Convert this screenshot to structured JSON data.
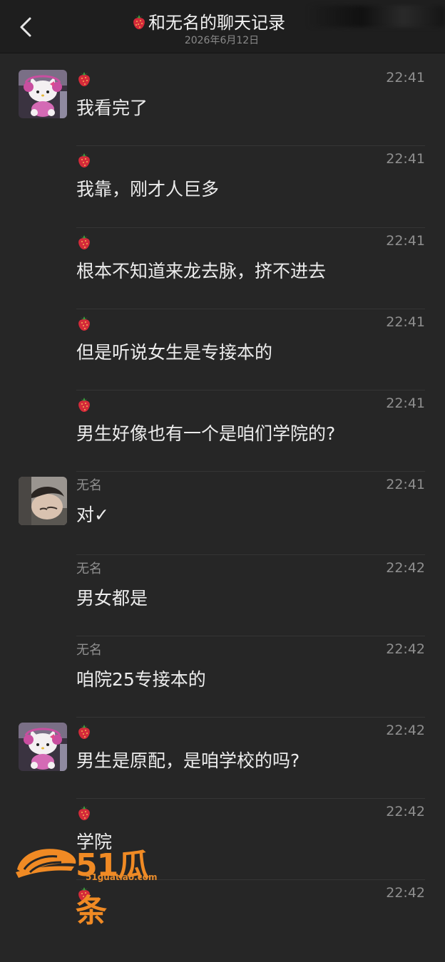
{
  "header": {
    "title": "和无名的聊天记录",
    "date": "2026年6月12日"
  },
  "messages": [
    {
      "sender": "🍓",
      "time": "22:41",
      "text": "我看完了",
      "avatar": "hello-kitty"
    },
    {
      "sender": "🍓",
      "time": "22:41",
      "text": "我靠，刚才人巨多"
    },
    {
      "sender": "🍓",
      "time": "22:41",
      "text": "根本不知道来龙去脉，挤不进去"
    },
    {
      "sender": "🍓",
      "time": "22:41",
      "text": "但是听说女生是专接本的"
    },
    {
      "sender": "🍓",
      "time": "22:41",
      "text": "男生好像也有一个是咱们学院的?"
    },
    {
      "sender": "无名",
      "time": "22:41",
      "text": "对✓",
      "avatar": "person"
    },
    {
      "sender": "无名",
      "time": "22:42",
      "text": "男女都是"
    },
    {
      "sender": "无名",
      "time": "22:42",
      "text": "咱院25专接本的"
    },
    {
      "sender": "🍓",
      "time": "22:42",
      "text": "男生是原配，是咱学校的吗?",
      "avatar": "hello-kitty"
    },
    {
      "sender": "🍓",
      "time": "22:42",
      "text": "学院"
    },
    {
      "sender": "🍓",
      "time": "22:42",
      "text": ""
    }
  ],
  "watermark": {
    "brand": "51瓜条",
    "url": "51guatiao.com"
  },
  "icons": {
    "back": "chevron-left-icon",
    "sender_badge": "strawberry-icon"
  },
  "colors": {
    "background": "#262626",
    "header": "#1e1e1e",
    "accent": "#f08a24"
  }
}
